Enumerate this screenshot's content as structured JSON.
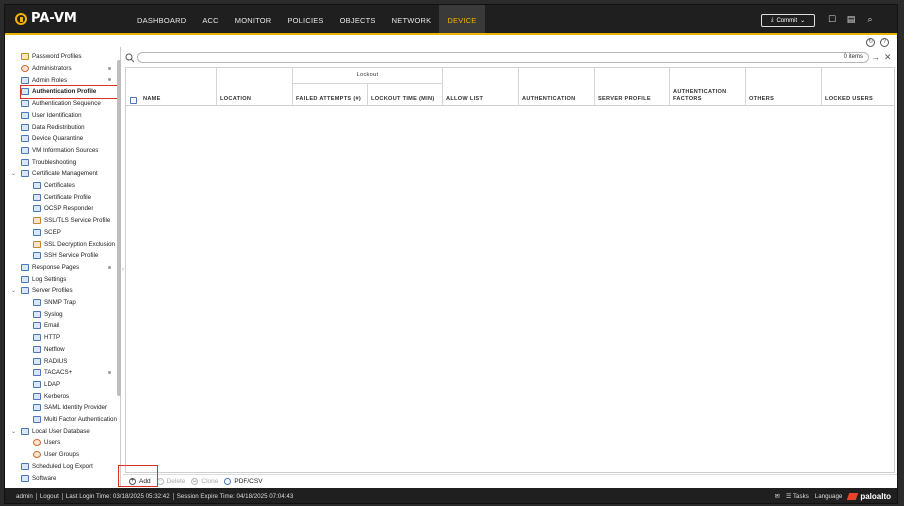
{
  "app": {
    "title": "PA-VM"
  },
  "nav": {
    "tabs": [
      {
        "label": "DASHBOARD",
        "active": false
      },
      {
        "label": "ACC",
        "active": false
      },
      {
        "label": "MONITOR",
        "active": false
      },
      {
        "label": "POLICIES",
        "active": false
      },
      {
        "label": "OBJECTS",
        "active": false
      },
      {
        "label": "NETWORK",
        "active": false
      },
      {
        "label": "DEVICE",
        "active": true
      }
    ],
    "commit_label": "Commit"
  },
  "sidebar": {
    "items": [
      {
        "label": "Password Profiles",
        "indent": 1,
        "icon": "password-icon"
      },
      {
        "label": "Administrators",
        "indent": 1,
        "icon": "user-icon",
        "dot": true
      },
      {
        "label": "Admin Roles",
        "indent": 1,
        "icon": "roles-icon",
        "dot": true
      },
      {
        "label": "Authentication Profile",
        "indent": 1,
        "icon": "auth-profile-icon",
        "selected": true
      },
      {
        "label": "Authentication Sequence",
        "indent": 1,
        "icon": "auth-sequence-icon"
      },
      {
        "label": "User Identification",
        "indent": 1,
        "icon": "user-id-icon"
      },
      {
        "label": "Data Redistribution",
        "indent": 1,
        "icon": "data-redist-icon"
      },
      {
        "label": "Device Quarantine",
        "indent": 1,
        "icon": "quarantine-icon"
      },
      {
        "label": "VM Information Sources",
        "indent": 1,
        "icon": "vm-info-icon"
      },
      {
        "label": "Troubleshooting",
        "indent": 1,
        "icon": "troubleshoot-icon"
      },
      {
        "label": "Certificate Management",
        "indent": 1,
        "icon": "cert-mgmt-icon",
        "caret": true
      },
      {
        "label": "Certificates",
        "indent": 2,
        "icon": "certificate-icon"
      },
      {
        "label": "Certificate Profile",
        "indent": 2,
        "icon": "cert-profile-icon"
      },
      {
        "label": "OCSP Responder",
        "indent": 2,
        "icon": "ocsp-icon"
      },
      {
        "label": "SSL/TLS Service Profile",
        "indent": 2,
        "icon": "lock-icon"
      },
      {
        "label": "SCEP",
        "indent": 2,
        "icon": "scep-icon"
      },
      {
        "label": "SSL Decryption Exclusion",
        "indent": 2,
        "icon": "lock-icon"
      },
      {
        "label": "SSH Service Profile",
        "indent": 2,
        "icon": "ssh-icon"
      },
      {
        "label": "Response Pages",
        "indent": 1,
        "icon": "response-pages-icon",
        "dot": true
      },
      {
        "label": "Log Settings",
        "indent": 1,
        "icon": "log-settings-icon"
      },
      {
        "label": "Server Profiles",
        "indent": 1,
        "icon": "server-profiles-icon",
        "caret": true
      },
      {
        "label": "SNMP Trap",
        "indent": 2,
        "icon": "snmp-icon"
      },
      {
        "label": "Syslog",
        "indent": 2,
        "icon": "syslog-icon"
      },
      {
        "label": "Email",
        "indent": 2,
        "icon": "email-icon"
      },
      {
        "label": "HTTP",
        "indent": 2,
        "icon": "http-icon"
      },
      {
        "label": "Netflow",
        "indent": 2,
        "icon": "netflow-icon"
      },
      {
        "label": "RADIUS",
        "indent": 2,
        "icon": "radius-icon"
      },
      {
        "label": "TACACS+",
        "indent": 2,
        "icon": "tacacs-icon",
        "dot": true
      },
      {
        "label": "LDAP",
        "indent": 2,
        "icon": "ldap-icon"
      },
      {
        "label": "Kerberos",
        "indent": 2,
        "icon": "kerberos-icon"
      },
      {
        "label": "SAML Identity Provider",
        "indent": 2,
        "icon": "saml-icon"
      },
      {
        "label": "Multi Factor Authentication",
        "indent": 2,
        "icon": "mfa-icon"
      },
      {
        "label": "Local User Database",
        "indent": 1,
        "icon": "local-db-icon",
        "caret": true
      },
      {
        "label": "Users",
        "indent": 2,
        "icon": "user-icon"
      },
      {
        "label": "User Groups",
        "indent": 2,
        "icon": "user-groups-icon"
      },
      {
        "label": "Scheduled Log Export",
        "indent": 1,
        "icon": "log-export-icon"
      },
      {
        "label": "Software",
        "indent": 1,
        "icon": "software-icon"
      }
    ]
  },
  "search": {
    "placeholder": "",
    "count": "0 items"
  },
  "table": {
    "group_header": "Lockout",
    "columns": [
      "NAME",
      "LOCATION",
      "FAILED ATTEMPTS (#)",
      "LOCKOUT TIME (MIN)",
      "ALLOW LIST",
      "AUTHENTICATION",
      "SERVER PROFILE",
      "AUTHENTICATION FACTORS",
      "OTHERS",
      "LOCKED USERS"
    ],
    "rows": []
  },
  "actions": {
    "add": "Add",
    "delete": "Delete",
    "clone": "Clone",
    "pdf": "PDF/CSV"
  },
  "status": {
    "user": "admin",
    "logout": "Logout",
    "last_login": "Last Login Time: 03/18/2025 05:32:42",
    "session_expire": "Session Expire Time: 04/18/2025 07:04:43",
    "tasks": "Tasks",
    "language": "Language",
    "brand": "paloalto"
  }
}
